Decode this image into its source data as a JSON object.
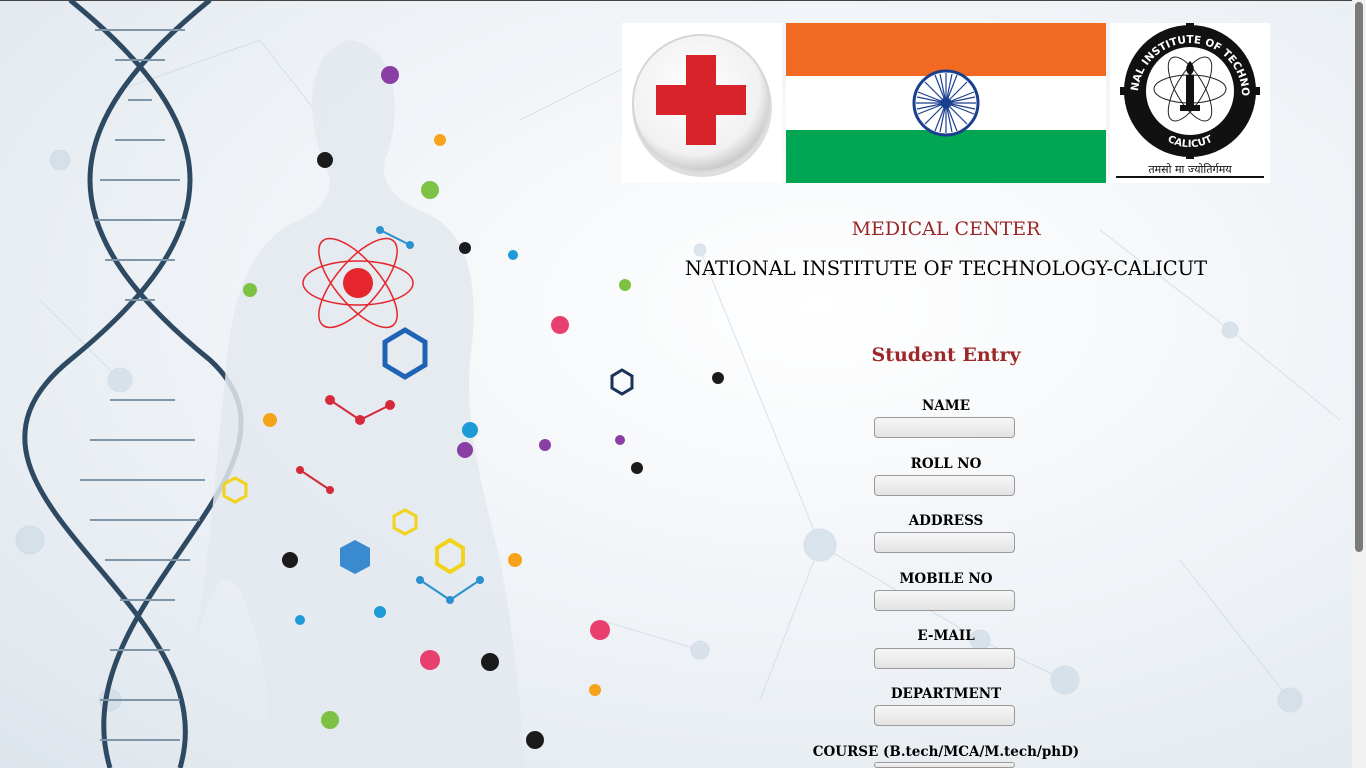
{
  "header": {
    "subtitle": "MEDICAL CENTER",
    "title": "NATIONAL INSTITUTE OF TECHNOLOGY-CALICUT"
  },
  "logos": {
    "nit_ring_text": "NATIONAL INSTITUTE OF TECHNOLOGY",
    "nit_bottom_text": "CALICUT",
    "nit_motto": "तमसो मा ज्योतिर्गमय"
  },
  "form": {
    "title": "Student Entry",
    "fields": [
      {
        "label": "NAME",
        "value": ""
      },
      {
        "label": "ROLL NO",
        "value": ""
      },
      {
        "label": "ADDRESS",
        "value": ""
      },
      {
        "label": "MOBILE NO",
        "value": ""
      },
      {
        "label": "E-MAIL",
        "value": ""
      },
      {
        "label": "DEPARTMENT",
        "value": ""
      },
      {
        "label": "COURSE (B.tech/MCA/M.tech/phD)",
        "value": ""
      }
    ]
  },
  "colors": {
    "heading_red": "#9b2727",
    "flag_saffron": "#f26a21",
    "flag_green": "#00a651",
    "chakra_blue": "#1b3f8f",
    "red_cross": "#d8232a"
  },
  "icons": [
    "red-cross-icon",
    "india-flag-icon",
    "nit-calicut-emblem-icon"
  ]
}
